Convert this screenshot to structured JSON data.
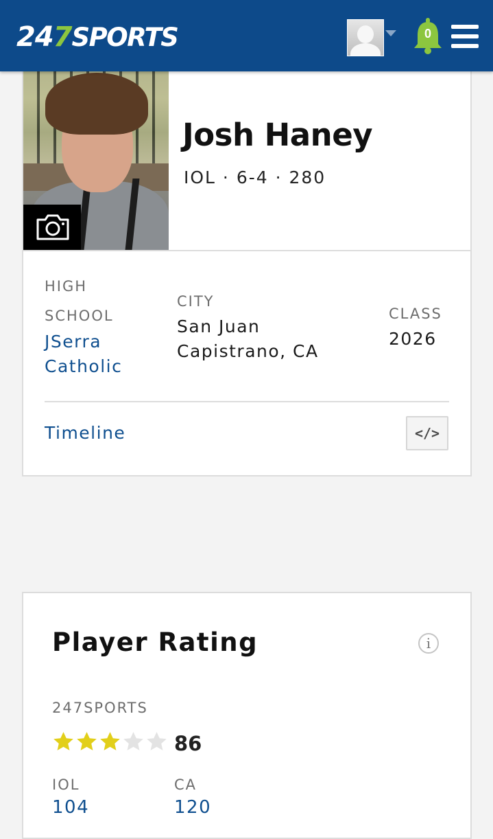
{
  "header": {
    "logo_num_a": "24",
    "logo_num_b": "7",
    "logo_word": "SPORTS",
    "notification_count": "0",
    "brand_color": "#0d4a8a",
    "accent_color": "#8cc63f",
    "icons": [
      "user-avatar-icon",
      "caret-down-icon",
      "bell-icon",
      "hamburger-menu-icon"
    ]
  },
  "player": {
    "name": "Josh Haney",
    "meta": "IOL · 6-4 · 280",
    "high_school_label_1": "HIGH",
    "high_school_label_2": "SCHOOL",
    "high_school_1": "JSerra",
    "high_school_2": "Catholic",
    "city_label": "CITY",
    "city_1": "San Juan",
    "city_2": "Capistrano, CA",
    "class_label": "CLASS",
    "class_year": "2026",
    "timeline_link": "Timeline",
    "embed_label": "</>"
  },
  "rating": {
    "title": "Player Rating",
    "info_label": "i",
    "source_label": "247SPORTS",
    "stars_filled": 3,
    "stars_total": 5,
    "score": "86",
    "position_label": "IOL",
    "position_rank": "104",
    "state_label": "CA",
    "state_rank": "120",
    "star_color": "#e2cf1a",
    "star_empty_color": "#e3e3e3"
  }
}
